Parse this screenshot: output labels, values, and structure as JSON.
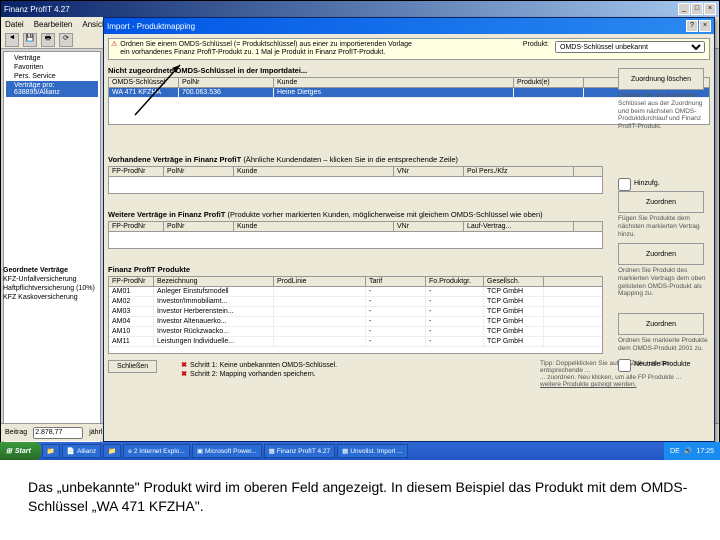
{
  "main": {
    "title": "Finanz ProfIT 4.27",
    "menu": [
      "Datei",
      "Bearbeiten",
      "Ansicht",
      "?"
    ],
    "tree": {
      "root": "Verträge",
      "items": [
        "Favoriten",
        "Pers. Service",
        "Verträge pro: 638895/Allianz"
      ]
    },
    "lowerLeft": {
      "hdr": "Geordnete Verträge",
      "items": [
        "KFZ-Unfallversicherung",
        "Haftpflichtversicherung (10%)",
        "KFZ Kaskoversicherung"
      ]
    },
    "bottom": {
      "label": "Beitrag",
      "val": "2.878,77",
      "unit": "jährl."
    }
  },
  "dialog": {
    "title": "Import - Produktmapping",
    "info1": "Ordnen Sie einem OMDS-Schlüssel (= Produktschlüssel) aus einer zu importierenden Vorlage",
    "info2": "ein vorhandenes Finanz ProfIT-Produkt zu. 1 Mal je Produkt in Finanz ProfIT-Produkt.",
    "prodLabel": "Produkt:",
    "prodSel": "OMDS-Schlüssel unbekannt",
    "sec1": "Nicht zugeordnete OMDS-Schlüssel in der Importdatei...",
    "grid1": {
      "cols": [
        "OMDS-Schlüssel",
        "PolNr",
        "Kunde",
        "Produkt(e)"
      ],
      "rows": [
        [
          "WA 471 KFZHA",
          "700.063.536",
          "Heine Dietges",
          ""
        ]
      ]
    },
    "sec2": "Vorhandene Verträge in Finanz ProfiT",
    "sec2note": "(Ähnliche Kundendaten – klicken Sie in die entsprechende Zeile)",
    "grid2": {
      "cols": [
        "FP-ProdNr",
        "PolNr",
        "Kunde",
        "VNr",
        "Pol Pers./Kfz"
      ]
    },
    "sec3": "Weitere Verträge in Finanz ProfiT",
    "sec3note": "(Produkte vorher markierten Kunden, möglicherweise mit gleichem OMDS-Schlüssel wie oben)",
    "grid3": {
      "cols": [
        "FP-ProdNr",
        "PolNr",
        "Kunde",
        "VNr",
        "Lauf-Vertrag..."
      ]
    },
    "sec4": "Finanz ProfIT Produkte",
    "grid4": {
      "cols": [
        "FP-ProdNr",
        "Bezeichnung",
        "ProdLinie",
        "Tarif",
        "Fo.Produktgr.",
        "Gesellsch."
      ],
      "rows": [
        [
          "AM01",
          "Anleger Einstufsmodell",
          "",
          "-",
          "-",
          "TCP GmbH"
        ],
        [
          "AM02",
          "Investor/Immobiliamt...",
          "",
          "-",
          "-",
          "TCP GmbH"
        ],
        [
          "AM03",
          "Investor Herberenstein...",
          "",
          "-",
          "-",
          "TCP GmbH"
        ],
        [
          "AM04",
          "Investor Altenauerko...",
          "",
          "-",
          "-",
          "TCP GmbH"
        ],
        [
          "AM10",
          "Investor Rückzwacko...",
          "",
          "-",
          "-",
          "TCP GmbH"
        ],
        [
          "AM11",
          "Leistungen Individuelle...",
          "",
          "-",
          "-",
          "TCP GmbH"
        ]
      ]
    },
    "r1btn": "Zuordnung löschen",
    "r1note": "Löschen Sie die markierten Schlüssel aus der Zuordnung und beim nächsten OMDS-Produktdurchlauf und Finanz ProfIT-Produkt.",
    "r2lbl": "Hinzufg.",
    "r2btn": "Zuordnen",
    "r2note": "Fügen Sie Produkte dem nächsten markierten Vertrag hinzu.",
    "r3btn": "Zuordnen",
    "r3note": "Ordnen Sie Produkt des markierten Vertrags dem oben gelisteten OMDS-Produkt als Mapping zu.",
    "r4btn": "Zuordnen",
    "r4note": "Ordnen Sie markierte Produkte dem OMDS-Produkt 2001 zu.",
    "r4chk": "Neutrale Produkte",
    "status1": "Schritt 1: Keine unbekannten OMDS-Schlüssel.",
    "status2": "Schritt 2: Mapping vorhanden speichern.",
    "foot1": "Tipp: Doppelklicken Sie auf die Zeile, um das entsprechende ...",
    "foot2": "... zuordnen. Neu klicken, um alle FP Produkte ...",
    "foot3": "weitere Produkte gezeigt werden.",
    "close": "Schließen"
  },
  "taskbar": {
    "start": "Start",
    "items": [
      "",
      "Allianz",
      "",
      "2 Internet Explo...",
      "Microsoft Power...",
      "Finanz ProfIT 4.27",
      "Unvollst. Import ..."
    ],
    "lang": "DE",
    "time": "17:25"
  },
  "caption": "Das „unbekannte\" Produkt wird im oberen Feld angezeigt. In diesem Beispiel das Produkt mit dem OMDS-Schlüssel „WA 471 KFZHA\"."
}
